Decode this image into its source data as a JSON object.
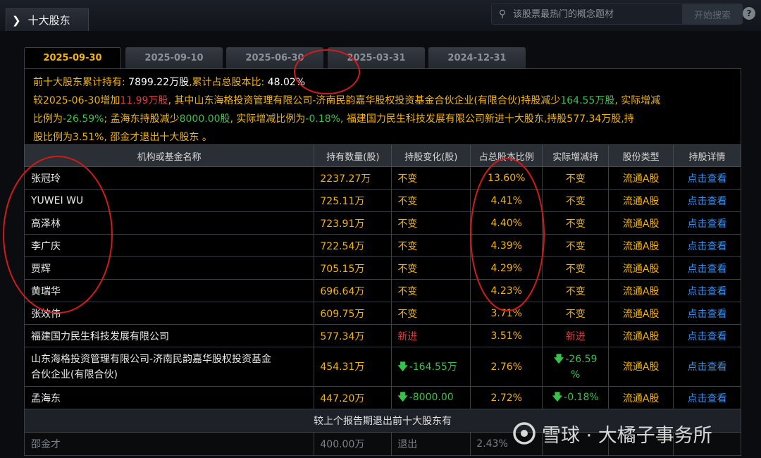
{
  "header": {
    "title": "十大股东",
    "search_placeholder": "该股票最热门的概念题材",
    "search_button": "开始搜索",
    "info": "?"
  },
  "date_tabs": [
    "2025-09-30",
    "2025-09-10",
    "2025-06-30",
    "2025-03-31",
    "2024-12-31"
  ],
  "summary": {
    "l1_a": "前十大股东累计持有:",
    "l1_b": "7899.22万股",
    "l1_c": ",累计占总股本比:",
    "l1_d": "48.02%",
    "l2_a": "较2025-06-30增加",
    "l2_b": "11.99万股",
    "l2_c": ", 其中山东海格投资管理有限公司-济南民韵嘉华股权投资基金合伙企业(有限合伙)持股减少",
    "l2_d": "164.55万股",
    "l2_e": ", 实际增减",
    "l3_a": "比例为",
    "l3_b": "-26.59%",
    "l3_c": "; 孟海东持股减少",
    "l3_d": "8000.00股",
    "l3_e": ", 实际增减比例为",
    "l3_f": "-0.18%",
    "l3_g": ", 福建国力民生科技发展有限公司新进十大股东,持股577.34万股,持",
    "l4": "股比例为3.51%, 邵金才退出十大股东 。"
  },
  "table": {
    "headers": [
      "机构或基金名称",
      "持有数量(股)",
      "持股变化(股)",
      "占总股本比例",
      "实际增减持",
      "股份类型",
      "持股详情"
    ],
    "rows": [
      {
        "name": "张冠玲",
        "hold": "2237.27万",
        "chg": "不变",
        "pct": "13.60%",
        "act": "不变",
        "type": "流通A股",
        "detail": "点击查看"
      },
      {
        "name": "YUWEI WU",
        "hold": "725.11万",
        "chg": "不变",
        "pct": "4.41%",
        "act": "不变",
        "type": "流通A股",
        "detail": "点击查看"
      },
      {
        "name": "高泽林",
        "hold": "723.91万",
        "chg": "不变",
        "pct": "4.40%",
        "act": "不变",
        "type": "流通A股",
        "detail": "点击查看"
      },
      {
        "name": "李广庆",
        "hold": "722.54万",
        "chg": "不变",
        "pct": "4.39%",
        "act": "不变",
        "type": "流通A股",
        "detail": "点击查看"
      },
      {
        "name": "贾辉",
        "hold": "705.15万",
        "chg": "不变",
        "pct": "4.29%",
        "act": "不变",
        "type": "流通A股",
        "detail": "点击查看"
      },
      {
        "name": "黄瑞华",
        "hold": "696.64万",
        "chg": "不变",
        "pct": "4.23%",
        "act": "不变",
        "type": "流通A股",
        "detail": "点击查看"
      },
      {
        "name": "张效伟",
        "hold": "609.75万",
        "chg": "不变",
        "pct": "3.71%",
        "act": "不变",
        "type": "流通A股",
        "detail": "点击查看"
      },
      {
        "name": "福建国力民生科技发展有限公司",
        "hold": "577.34万",
        "chg": "新进",
        "pct": "3.51%",
        "act": "新进",
        "type": "流通A股",
        "detail": "点击查看"
      }
    ],
    "row_shandong": {
      "name_1": "山东海格投资管理有限公司-济南民韵嘉华股权投资基金",
      "name_2": "合伙企业(有限合伙)",
      "hold": "454.31万",
      "chg": "-164.55万",
      "pct": "2.76%",
      "act_1": "-26.59",
      "act_2": "%",
      "type": "流通A股",
      "detail": "点击查看"
    },
    "row_meng": {
      "name": "孟海东",
      "hold": "447.20万",
      "chg": "-8000.00",
      "pct": "2.72%",
      "act": "-0.18%",
      "type": "流通A股",
      "detail": "点击查看"
    },
    "exit_header": "较上个报告期退出前十大股东有",
    "exit_row": {
      "name": "邵金才",
      "hold": "400.00万",
      "chg": "退出",
      "pct": "2.43%"
    }
  },
  "watermark": {
    "text": "雪球 · 大橘子事务所"
  },
  "colors": {
    "accent": "#f5b400",
    "up": "#e33a3a",
    "down": "#37c24a",
    "link": "#3d8fe0",
    "annotation": "#d11a1a"
  }
}
